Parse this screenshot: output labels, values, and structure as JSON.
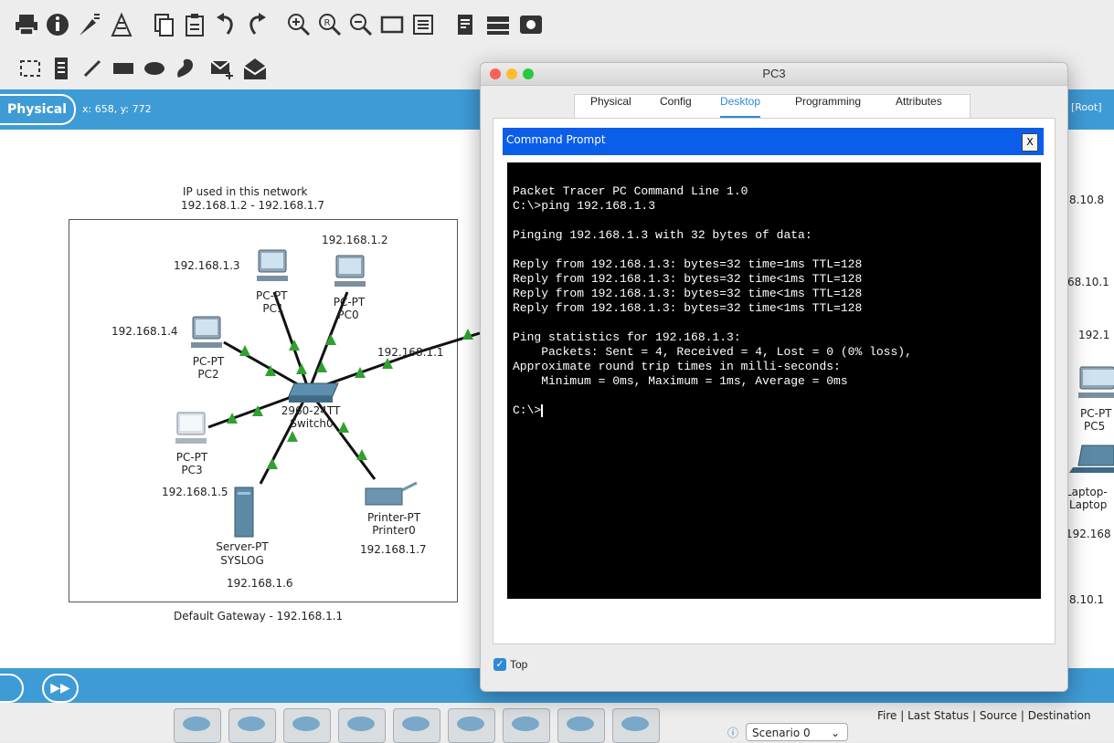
{
  "toolbar": {
    "row1_icons": [
      "print-icon",
      "info-icon",
      "activity-wizard-icon",
      "network-info-icon",
      "copy-icon",
      "paste-icon",
      "undo-icon",
      "redo-icon",
      "zoom-in-icon",
      "zoom-reset-icon",
      "zoom-out-icon",
      "drawing-palette-icon",
      "custom-device-dialog-icon",
      "text-file-icon",
      "ipc-icon",
      "screenshot-icon"
    ],
    "row2_icons": [
      "select-icon",
      "note-icon",
      "line-icon",
      "rectangle-icon",
      "ellipse-icon",
      "freeform-icon",
      "simple-pdu-icon",
      "complex-pdu-icon"
    ]
  },
  "workspace": {
    "physical_tab": "Physical",
    "coords": "x: 658, y: 772",
    "root_label": "[Root]"
  },
  "canvas": {
    "note_title": "IP used in this network",
    "note_range": "192.168.1.2 - 192.168.1.7",
    "gateway_note": "Default Gateway - 192.168.1.1",
    "switch_ip": "192.168.1.1",
    "devices": {
      "pc0": {
        "type": "PC-PT",
        "name": "PC0",
        "ip": "192.168.1.2"
      },
      "pc1": {
        "type": "PC-PT",
        "name": "PC1",
        "ip": "192.168.1.3"
      },
      "pc2": {
        "type": "PC-PT",
        "name": "PC2",
        "ip": "192.168.1.4"
      },
      "pc3": {
        "type": "PC-PT",
        "name": "PC3",
        "ip": "192.168.1.5"
      },
      "switch": {
        "type": "2960-24TT",
        "name": "Switch0"
      },
      "server": {
        "type": "Server-PT",
        "name": "SYSLOG",
        "ip": "192.168.1.6"
      },
      "printer": {
        "type": "Printer-PT",
        "name": "Printer0",
        "ip": "192.168.1.7"
      }
    },
    "right_partial": {
      "ip_a": "8.10.8",
      "ip_b": "68.10.1",
      "ip_c": "192.1",
      "pc5_type": "PC-PT",
      "pc5_name": "PC5",
      "laptop_type": "Laptop-",
      "laptop_name": "Laptop",
      "ip_d": "192.168",
      "ip_e": "8.10.1"
    }
  },
  "window": {
    "title": "PC3",
    "tabs": [
      "Physical",
      "Config",
      "Desktop",
      "Programming",
      "Attributes"
    ],
    "active_tab": "Desktop",
    "cmd_title": "Command Prompt",
    "close_label": "X",
    "terminal_lines": [
      "Packet Tracer PC Command Line 1.0",
      "C:\\>ping 192.168.1.3",
      "",
      "Pinging 192.168.1.3 with 32 bytes of data:",
      "",
      "Reply from 192.168.1.3: bytes=32 time=1ms TTL=128",
      "Reply from 192.168.1.3: bytes=32 time<1ms TTL=128",
      "Reply from 192.168.1.3: bytes=32 time<1ms TTL=128",
      "Reply from 192.168.1.3: bytes=32 time<1ms TTL=128",
      "",
      "Ping statistics for 192.168.1.3:",
      "    Packets: Sent = 4, Received = 4, Lost = 0 (0% loss),",
      "Approximate round trip times in milli-seconds:",
      "    Minimum = 0ms, Maximum = 1ms, Average = 0ms",
      ""
    ],
    "prompt": "C:\\>",
    "top_label": "Top",
    "top_checked": true
  },
  "bottom": {
    "scenario": "Scenario 0",
    "status_columns": [
      "Fire",
      "Last Status",
      "Source",
      "Destination"
    ]
  },
  "colors": {
    "accent_blue": "#3f9bd6",
    "cmd_blue": "#0a5ee9",
    "link_green": "#2fa12f",
    "tab_active": "#2f8ad3"
  }
}
